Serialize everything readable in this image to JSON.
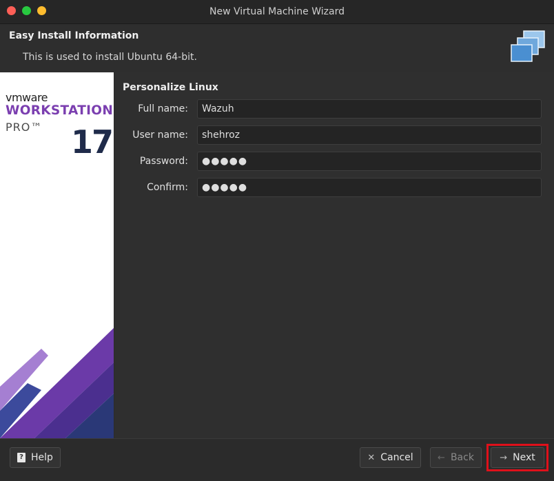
{
  "window": {
    "title": "New Virtual Machine Wizard"
  },
  "header": {
    "title": "Easy Install Information",
    "subtitle": "This is used to install Ubuntu 64-bit."
  },
  "sidebar": {
    "brand": "vmware",
    "product": "WORKSTATION",
    "edition": "PRO™",
    "version": "17"
  },
  "form": {
    "section_title": "Personalize Linux",
    "fields": [
      {
        "label": "Full name:",
        "value": "Wazuh",
        "type": "text"
      },
      {
        "label": "User name:",
        "value": "shehroz",
        "type": "text"
      },
      {
        "label": "Password:",
        "value": "●●●●●",
        "type": "password"
      },
      {
        "label": "Confirm:",
        "value": "●●●●●",
        "type": "password"
      }
    ]
  },
  "footer": {
    "help_label": "Help",
    "cancel_label": "Cancel",
    "back_label": "Back",
    "next_label": "Next"
  },
  "colors": {
    "accent_purple": "#7b3fb0",
    "highlight_red": "#e0101a"
  }
}
